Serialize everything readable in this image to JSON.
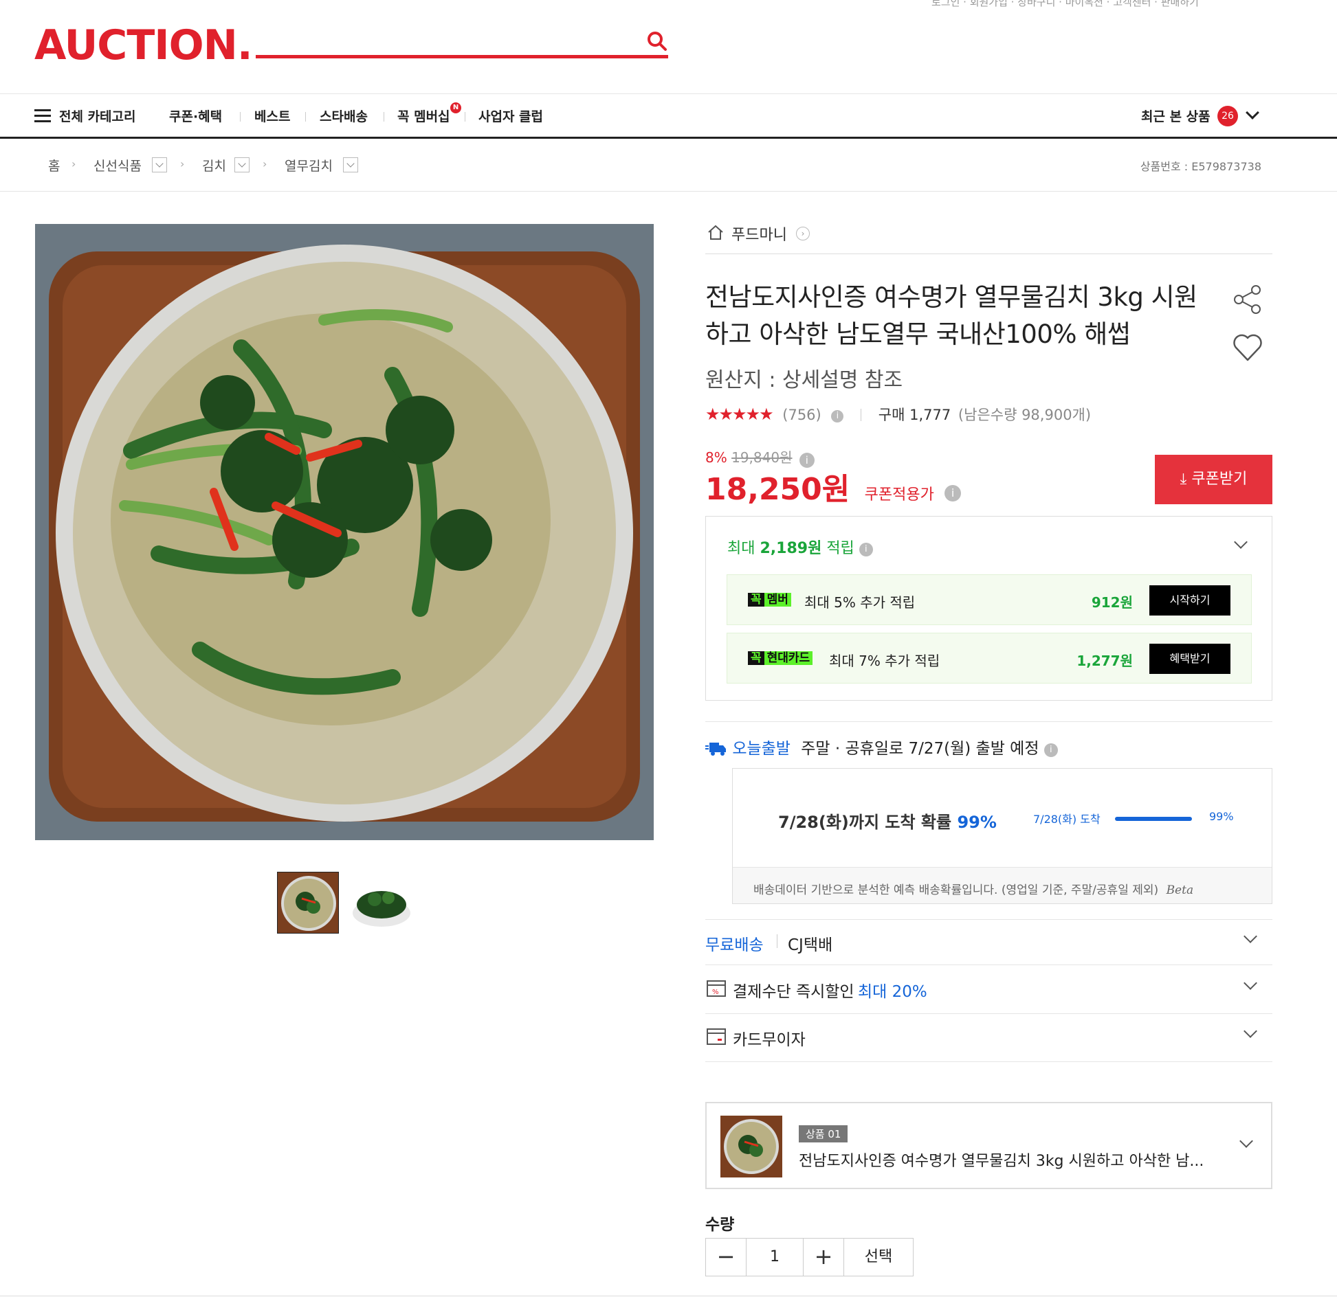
{
  "header": {
    "top_links": "로그인 · 회원가입 · 장바구니 · 마이옥션 · 고객센터 · 판매하기",
    "logo": "AUCTION.",
    "search_placeholder": ""
  },
  "nav": {
    "all_categories": "전체 카테고리",
    "items": [
      "쿠폰·혜택",
      "베스트",
      "스타배송",
      "꼭 멤버십",
      "사업자 클럽"
    ],
    "membership_badge": "N",
    "recent_label": "최근 본 상품",
    "recent_count": "26"
  },
  "breadcrumb": {
    "items": [
      "홈",
      "신선식품",
      "김치",
      "열무김치"
    ],
    "product_no": "상품번호 : E579873738"
  },
  "product": {
    "seller": "푸드마니",
    "title": "전남도지사인증 여수명가 열무물김치 3kg 시원하고 아삭한 남도열무 국내산100% 해썹",
    "origin": "원산지 : 상세설명 참조",
    "rating": 4.5,
    "stars": "★★★★★",
    "review_count": "(756)",
    "purchase": "구매 1,777",
    "stock": "(남은수량 98,900개)",
    "discount_pct": "8%",
    "original_price": "19,840원",
    "price": "18,250원",
    "price_label": "쿠폰적용가",
    "coupon_button": "쿠폰받기"
  },
  "reward": {
    "head_prefix": "최대",
    "head_amount": "2,189원",
    "head_suffix": "적립",
    "items": [
      {
        "badge_k": "꼭",
        "badge_v": "멤버",
        "text": "최대 5% 추가 적립",
        "amount": "912원",
        "button": "시작하기"
      },
      {
        "badge_k": "꼭",
        "badge_v": "현대카드",
        "text": "최대 7% 추가 적립",
        "amount": "1,277원",
        "button": "혜택받기"
      }
    ]
  },
  "delivery": {
    "today_label": "오늘출발",
    "today_text": "주말 · 공휴일로 7/27(월) 출발 예정",
    "predict_title": "7/28(화)까지 도착 확률",
    "predict_pct": "99%",
    "predict_date": "7/28(화) 도착",
    "predict_bar_pct": "99%",
    "predict_note": "배송데이터 기반으로 분석한 예측 배송확률입니다. (영업일 기준, 주말/공휴일 제외)",
    "beta": "Beta"
  },
  "info_rows": {
    "shipping_free": "무료배송",
    "shipping_carrier": "CJ택배",
    "payment_label": "결제수단 즉시할인",
    "payment_highlight": "최대 20%",
    "card_installment": "카드무이자"
  },
  "option": {
    "tag": "상품 01",
    "name": "전남도지사인증 여수명가 열무물김치 3kg 시원하고 아삭한 남..."
  },
  "quantity": {
    "label": "수량",
    "value": "1",
    "select_button": "선택"
  },
  "colors": {
    "brand_red": "#e0212c",
    "green": "#1aa53a",
    "blue": "#1565d8"
  }
}
